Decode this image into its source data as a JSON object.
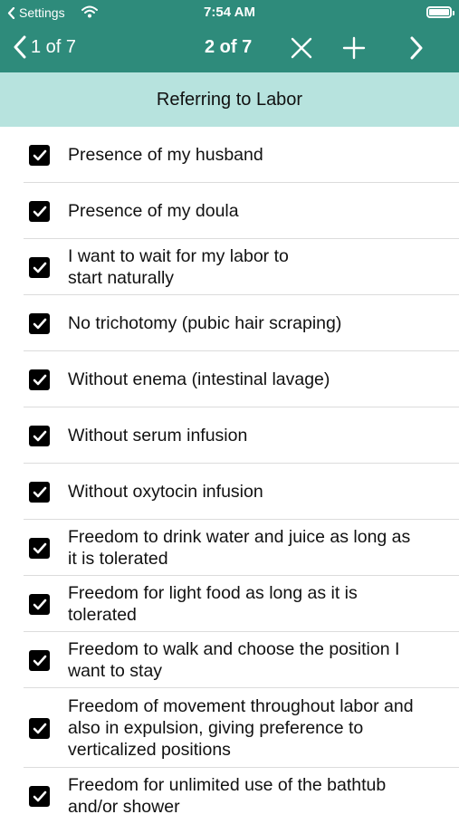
{
  "status_bar": {
    "back_label": "Settings",
    "time": "7:54 AM"
  },
  "nav": {
    "prev_label": "1 of 7",
    "current_label": "2 of 7"
  },
  "section_title": "Referring to Labor",
  "items": [
    {
      "label": "Presence of my husband",
      "checked": true
    },
    {
      "label": "Presence of my doula",
      "checked": true
    },
    {
      "label": "I want to wait for my labor to start naturally",
      "checked": true
    },
    {
      "label": "No trichotomy (pubic hair scraping)",
      "checked": true
    },
    {
      "label": "Without enema (intestinal lavage)",
      "checked": true
    },
    {
      "label": "Without serum infusion",
      "checked": true
    },
    {
      "label": "Without oxytocin infusion",
      "checked": true
    },
    {
      "label": "Freedom to drink water and juice as long as it is tolerated",
      "checked": true
    },
    {
      "label": "Freedom for light food as long as it is tolerated",
      "checked": true
    },
    {
      "label": "Freedom to walk and choose the position I want to stay",
      "checked": true
    },
    {
      "label": "Freedom of movement throughout labor and also in expulsion, giving preference to verticalized positions",
      "checked": true
    },
    {
      "label": "Freedom for unlimited use of the bathtub and/or shower",
      "checked": true
    }
  ],
  "colors": {
    "header": "#2e8b7b",
    "section": "#b7e3de"
  }
}
